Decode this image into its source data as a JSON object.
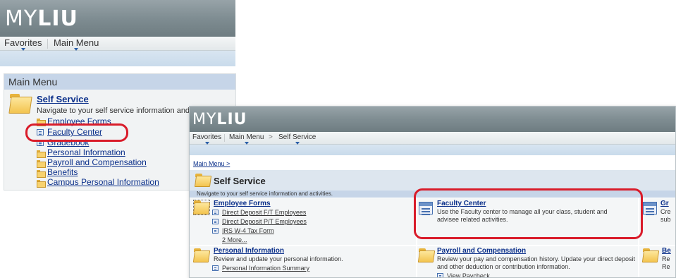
{
  "brand": {
    "logo_light": "MY",
    "logo_bold": "LIU"
  },
  "panel1": {
    "nav": {
      "favorites": "Favorites",
      "main_menu": "Main Menu"
    },
    "main_menu_title": "Main Menu",
    "self_service": {
      "title": "Self Service",
      "description": "Navigate to your self service information and activities.",
      "items": [
        {
          "label": "Employee Forms",
          "icon": "folder-icon"
        },
        {
          "label": "Faculty Center",
          "icon": "document-icon"
        },
        {
          "label": "Gradebook",
          "icon": "document-icon"
        },
        {
          "label": "Personal Information",
          "icon": "folder-icon"
        },
        {
          "label": "Payroll and Compensation",
          "icon": "folder-icon"
        },
        {
          "label": "Benefits",
          "icon": "folder-icon"
        },
        {
          "label": "Campus Personal Information",
          "icon": "folder-icon"
        }
      ]
    }
  },
  "panel2": {
    "nav": {
      "favorites": "Favorites",
      "main_menu": "Main Menu",
      "breadcrumb_sep": ">",
      "self_service": "Self Service"
    },
    "crumb": "Main Menu >",
    "title": "Self Service",
    "subtitle": "Navigate to your self service information and activities.",
    "employee_forms": {
      "title": "Employee Forms",
      "links": [
        "Direct Deposit F/T Employees",
        "Direct Deposit P/T Employees",
        "IRS W-4 Tax Form"
      ],
      "more": "2 More..."
    },
    "faculty_center": {
      "title": "Faculty Center",
      "description": "Use the Faculty center to manage all your class, student and advisee related activities."
    },
    "col3_top": {
      "title": "Gr",
      "line1": "Cre",
      "line2": "sub"
    },
    "personal_information": {
      "title": "Personal Information",
      "description": "Review and update your personal information.",
      "link": "Personal Information Summary"
    },
    "payroll": {
      "title": "Payroll and Compensation",
      "description": "Review your pay and compensation history. Update your direct deposit and other deduction or contribution information.",
      "link": "View Paycheck"
    },
    "col3_bottom": {
      "title": "Be",
      "line1": "Re",
      "line2": "Re"
    }
  },
  "colors": {
    "highlight": "#d91c2a",
    "link": "#0a2f8a",
    "header": "#7f8d92"
  }
}
